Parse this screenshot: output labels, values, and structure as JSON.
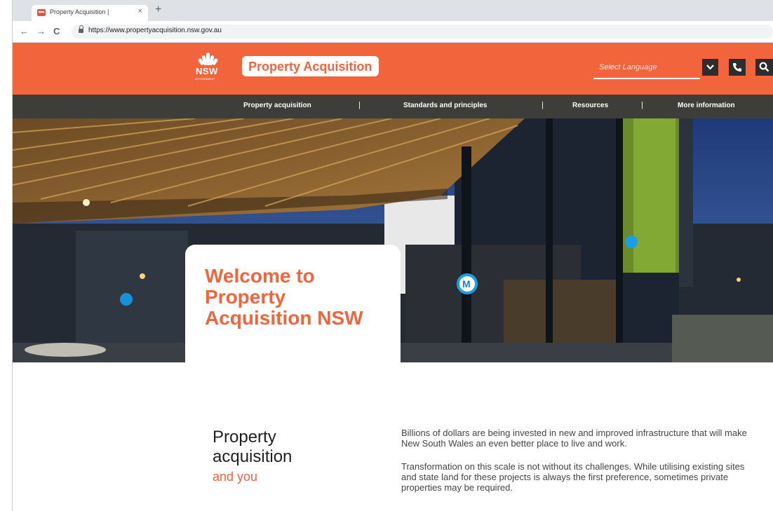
{
  "browser": {
    "tab_title": "Property Acquisition |",
    "tab_close": "×",
    "new_tab": "+",
    "back": "←",
    "forward": "→",
    "reload": "C",
    "url": "https://www.propertyacquisition.nsw.gov.au"
  },
  "header": {
    "logo_text": "NSW",
    "logo_sub": "GOVERNMENT",
    "brand": "Property Acquisition",
    "language_placeholder": "Select Language",
    "accent_color": "#f2643c",
    "icons": [
      "chevron-down-icon",
      "phone-icon",
      "search-icon"
    ]
  },
  "nav": {
    "items": [
      {
        "label": "Property acquisition"
      },
      {
        "label": "Standards and principles"
      },
      {
        "label": "Resources"
      },
      {
        "label": "More information"
      }
    ],
    "separator": "|"
  },
  "hero": {
    "title": "Welcome to Property Acquisition NSW",
    "badge_letter": "M"
  },
  "content": {
    "title": "Property acquisition",
    "subtitle": "and you",
    "paragraphs": [
      "Billions of dollars are being invested in new and improved infrastructure that will make New South Wales an even better place to live and work.",
      "Transformation on this scale is not without its challenges. While utilising existing sites and state land for these projects is always the first preference, sometimes private properties may be required."
    ]
  }
}
